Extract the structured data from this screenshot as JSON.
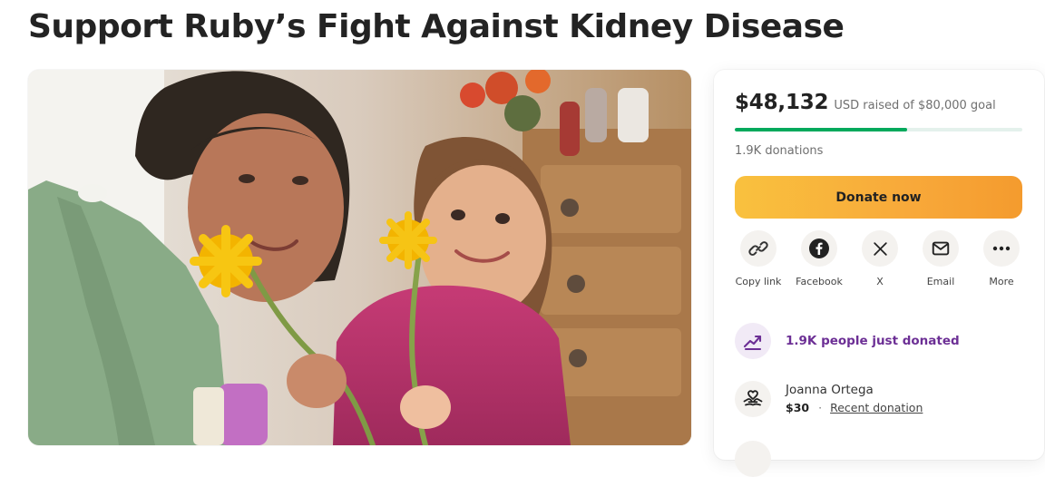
{
  "page": {
    "title": "Support Ruby’s Fight Against Kidney Disease"
  },
  "campaign_photo": {
    "icon": "campaign-photo"
  },
  "progress": {
    "amount_raised": "$48,132",
    "goal_text": "USD raised of $80,000 goal",
    "fraction": 0.6,
    "donations": "1.9K donations",
    "bar_color": "#02a95c",
    "track_color": "#e4f1ec"
  },
  "actions": {
    "donate_label": "Donate now",
    "donate_color": "#f9b13c"
  },
  "share": [
    {
      "label": "Copy link",
      "icon": "link-icon"
    },
    {
      "label": "Facebook",
      "icon": "facebook-icon"
    },
    {
      "label": "X",
      "icon": "x-icon"
    },
    {
      "label": "Email",
      "icon": "email-icon"
    },
    {
      "label": "More",
      "icon": "more-icon"
    }
  ],
  "activity": {
    "text": "1.9K people just donated",
    "icon": "trending-up-icon",
    "color": "#6c2f95"
  },
  "recent_donor": {
    "name": "Joanna Ortega",
    "amount": "$30",
    "label": "Recent donation",
    "icon": "heart-hands-icon"
  }
}
